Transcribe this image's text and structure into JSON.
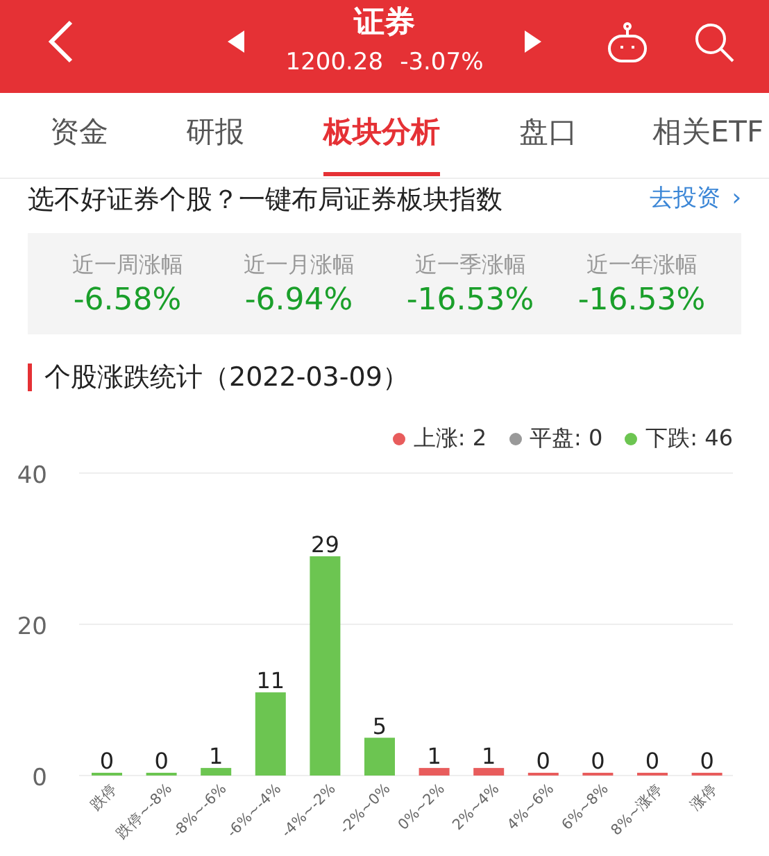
{
  "header": {
    "title": "证券",
    "price": "1200.28",
    "change": "-3.07%"
  },
  "tabs": [
    {
      "label": "资金",
      "selected": false
    },
    {
      "label": "研报",
      "selected": false
    },
    {
      "label": "板块分析",
      "selected": true
    },
    {
      "label": "盘口",
      "selected": false
    },
    {
      "label": "相关ETF",
      "selected": false
    }
  ],
  "promo": {
    "text": "选不好证券个股？一键布局证券板块指数",
    "link": "去投资",
    "link_icon": "›"
  },
  "returns": [
    {
      "label": "近一周涨幅",
      "value": "-6.58%"
    },
    {
      "label": "近一月涨幅",
      "value": "-6.94%"
    },
    {
      "label": "近一季涨幅",
      "value": "-16.53%"
    },
    {
      "label": "近一年涨幅",
      "value": "-16.53%"
    }
  ],
  "section_title": "个股涨跌统计（2022-03-09）",
  "legend": [
    {
      "label": "上涨: 2",
      "color": "#e85c5c"
    },
    {
      "label": "平盘: 0",
      "color": "#999999"
    },
    {
      "label": "下跌: 46",
      "color": "#6cc551"
    }
  ],
  "chart_data": {
    "type": "bar",
    "categories": [
      "跌停",
      "跌停~-8%",
      "-8%~-6%",
      "-6%~-4%",
      "-4%~-2%",
      "-2%~0%",
      "0%~2%",
      "2%~4%",
      "4%~6%",
      "6%~8%",
      "8%~涨停",
      "涨停"
    ],
    "series": [
      {
        "color": "#6cc551",
        "values": [
          0,
          0,
          1,
          11,
          29,
          5,
          null,
          null,
          null,
          null,
          null,
          null
        ]
      },
      {
        "color": "#e85c5c",
        "values": [
          null,
          null,
          null,
          null,
          null,
          null,
          1,
          1,
          0,
          0,
          0,
          0
        ]
      }
    ],
    "ylim": [
      0,
      40
    ],
    "yticks": [
      0,
      20,
      40
    ],
    "data_labels": true
  }
}
